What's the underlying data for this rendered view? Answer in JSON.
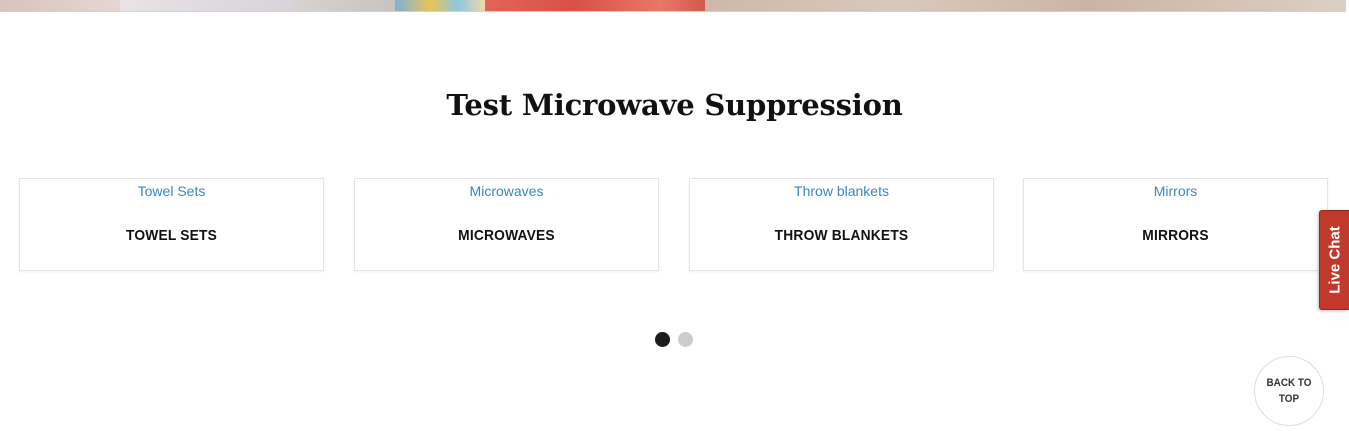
{
  "section": {
    "title": "Test Microwave Suppression"
  },
  "cards": [
    {
      "link": "Towel Sets",
      "name": "TOWEL SETS"
    },
    {
      "link": "Microwaves",
      "name": "MICROWAVES"
    },
    {
      "link": "Throw blankets",
      "name": "THROW BLANKETS"
    },
    {
      "link": "Mirrors",
      "name": "MIRRORS"
    }
  ],
  "pagination": {
    "total": 2,
    "active": 1
  },
  "widgets": {
    "live_chat_label": "Live Chat",
    "back_to_top_label": "BACK TO TOP"
  },
  "colors": {
    "link": "#3a86c4",
    "live_chat_bg": "#c0392b",
    "dot_active": "#1c1c1c",
    "dot_inactive": "#cccccc"
  }
}
